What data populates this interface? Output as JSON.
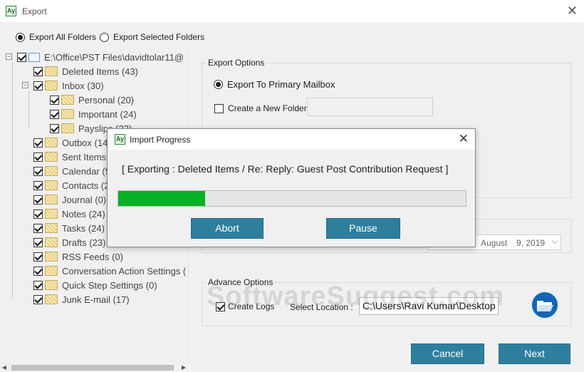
{
  "window": {
    "title": "Export",
    "icon": "app-logo-icon"
  },
  "export_mode": {
    "options": [
      {
        "label": "Export All Folders",
        "selected": true
      },
      {
        "label": "Export Selected Folders",
        "selected": false
      }
    ]
  },
  "tree": {
    "root": {
      "label": "E:\\Office\\PST Files\\davidtolar11@",
      "checked": true
    },
    "items": [
      {
        "label": "Deleted Items (43)",
        "level": 1,
        "checked": true
      },
      {
        "label": "Inbox (30)",
        "level": 1,
        "checked": true,
        "expanded": true
      },
      {
        "label": "Personal (20)",
        "level": 2,
        "checked": true
      },
      {
        "label": "Important (24)",
        "level": 2,
        "checked": true
      },
      {
        "label": "Payslips (22)",
        "level": 2,
        "checked": true
      },
      {
        "label": "Outbox (14)",
        "level": 1,
        "checked": true
      },
      {
        "label": "Sent Items",
        "level": 1,
        "checked": true
      },
      {
        "label": "Calendar (5",
        "level": 1,
        "checked": true
      },
      {
        "label": "Contacts (2",
        "level": 1,
        "checked": true
      },
      {
        "label": "Journal (0)",
        "level": 1,
        "checked": true
      },
      {
        "label": "Notes (24)",
        "level": 1,
        "checked": true
      },
      {
        "label": "Tasks (24)",
        "level": 1,
        "checked": true
      },
      {
        "label": "Drafts (23)",
        "level": 1,
        "checked": true
      },
      {
        "label": "RSS Feeds (0)",
        "level": 1,
        "checked": true
      },
      {
        "label": "Conversation Action Settings (",
        "level": 1,
        "checked": true
      },
      {
        "label": "Quick Step Settings (0)",
        "level": 1,
        "checked": true
      },
      {
        "label": "Junk E-mail (17)",
        "level": 1,
        "checked": true
      }
    ]
  },
  "export_options": {
    "legend": "Export Options",
    "primary_mailbox_label": "Export To Primary Mailbox",
    "new_folder_label": "Create a New Folder",
    "new_folder_value": ""
  },
  "date_filter": {
    "end_date": {
      "month": "August",
      "day_year": "9, 2019"
    }
  },
  "advance_options": {
    "legend": "Advance Options",
    "create_logs_label": "Create Logs",
    "create_logs_checked": true,
    "select_location_label": "Select Location :",
    "location_value": "C:\\Users\\Ravi Kumar\\Desktop"
  },
  "buttons": {
    "cancel": "Cancel",
    "next": "Next"
  },
  "watermark": "SoftwareSuggest.com",
  "dialog": {
    "title": "Import Progress",
    "status": "[ Exporting : Deleted Items / Re: Reply: Guest Post Contribution Request ]",
    "progress_fraction": 0.25,
    "progress_color": "#06b025",
    "abort_label": "Abort",
    "pause_label": "Pause"
  },
  "colors": {
    "button_blue": "#2e7f9e",
    "folder_button": "#1565b6"
  }
}
